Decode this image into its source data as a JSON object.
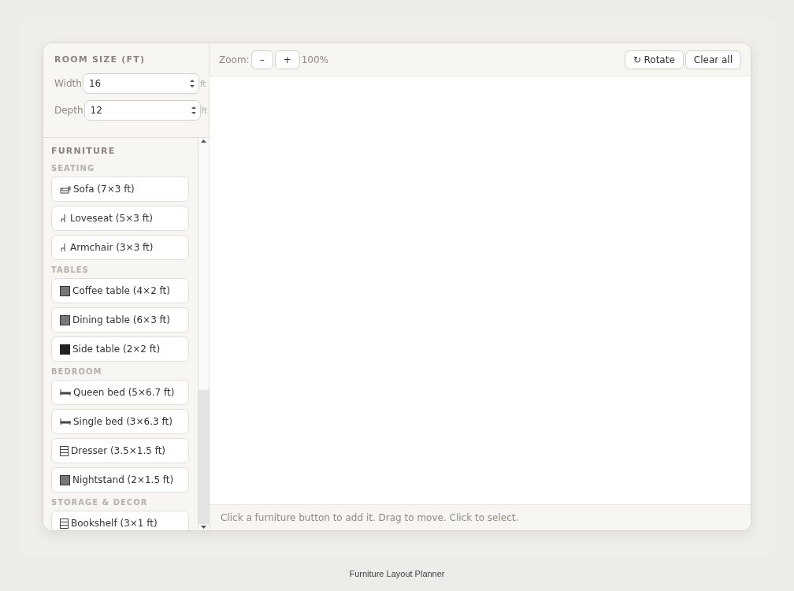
{
  "room_size": {
    "title": "ROOM SIZE (FT)",
    "fields": [
      {
        "label": "Width",
        "value": "16",
        "unit": "ft"
      },
      {
        "label": "Depth",
        "value": "12",
        "unit": "ft"
      }
    ]
  },
  "furniture": {
    "title": "FURNITURE",
    "groups": [
      {
        "name": "SEATING",
        "items": [
          {
            "label": "Sofa (7×3 ft)",
            "kind": "sofa"
          },
          {
            "label": "Loveseat (5×3 ft)",
            "kind": "chair"
          },
          {
            "label": "Armchair (3×3 ft)",
            "kind": "chair"
          }
        ]
      },
      {
        "name": "TABLES",
        "items": [
          {
            "label": "Coffee table (4×2 ft)",
            "kind": "table"
          },
          {
            "label": "Dining table (6×3 ft)",
            "kind": "table"
          },
          {
            "label": "Side table (2×2 ft)",
            "kind": "block"
          }
        ]
      },
      {
        "name": "BEDROOM",
        "items": [
          {
            "label": "Queen bed (5×6.7 ft)",
            "kind": "bed"
          },
          {
            "label": "Single bed (3×6.3 ft)",
            "kind": "bed"
          },
          {
            "label": "Dresser (3.5×1.5 ft)",
            "kind": "dresser"
          },
          {
            "label": "Nightstand (2×1.5 ft)",
            "kind": "table"
          }
        ]
      },
      {
        "name": "STORAGE & DECOR",
        "items": [
          {
            "label": "Bookshelf (3×1 ft)",
            "kind": "dresser"
          }
        ]
      }
    ]
  },
  "toolbar": {
    "zoom_label": "Zoom:",
    "zoom_out": "–",
    "zoom_in": "+",
    "zoom_value": "100%",
    "rotate": "↻ Rotate",
    "clear": "Clear all"
  },
  "status_bar": "Click a furniture button to add it. Drag to move. Click to select.",
  "caption": "Furniture Layout Planner"
}
